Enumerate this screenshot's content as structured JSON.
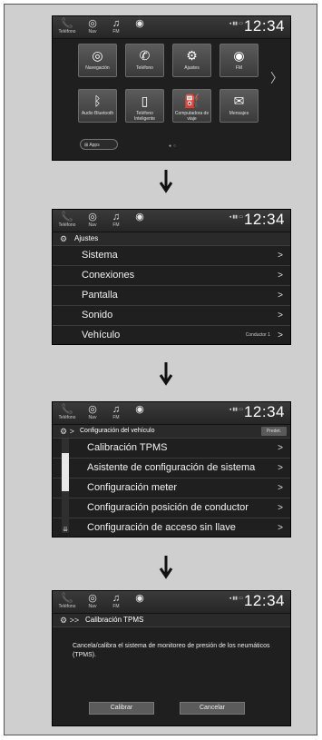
{
  "status": {
    "items": [
      {
        "label": "Teléfono",
        "icon": "phone-icon",
        "glyph": "📞"
      },
      {
        "label": "Nav",
        "icon": "navigation-icon",
        "glyph": "◎"
      },
      {
        "label": "FM",
        "icon": "radio-icon",
        "glyph": "♫"
      },
      {
        "label": "",
        "icon": "audio-source-icon",
        "glyph": "◉"
      }
    ],
    "clock": "12:34"
  },
  "home": {
    "tiles": [
      {
        "label": "Navegación",
        "icon": "navigation-icon",
        "glyph": "◎"
      },
      {
        "label": "Teléfono",
        "icon": "phone-icon",
        "glyph": "✆"
      },
      {
        "label": "Ajustes",
        "icon": "gear-icon",
        "glyph": "⚙"
      },
      {
        "label": "FM",
        "icon": "radio-icon",
        "glyph": "◉"
      },
      {
        "label": "Audio Bluetooth",
        "icon": "bluetooth-icon",
        "glyph": "ᛒ"
      },
      {
        "label": "Teléfono Inteligente",
        "icon": "smartphone-icon",
        "glyph": "▯"
      },
      {
        "label": "Computadora de viaje",
        "icon": "fuel-icon",
        "glyph": "⛽"
      },
      {
        "label": "Mensajes",
        "icon": "sms-icon",
        "glyph": "✉"
      }
    ],
    "apps_label": "Apps"
  },
  "settings": {
    "title": "Ajustes",
    "rows": [
      {
        "label": "Sistema",
        "value": ""
      },
      {
        "label": "Conexiones",
        "value": ""
      },
      {
        "label": "Pantalla",
        "value": ""
      },
      {
        "label": "Sonido",
        "value": ""
      },
      {
        "label": "Vehículo",
        "value": "Conductor 1"
      }
    ]
  },
  "vehicle": {
    "title": "Configuración del vehículo",
    "default_button": "Predet.",
    "rows": [
      {
        "label": "Calibración TPMS"
      },
      {
        "label": "Asistente de configuración de sistema"
      },
      {
        "label": "Configuración meter"
      },
      {
        "label": "Configuración posición de conductor"
      },
      {
        "label": "Configuración de acceso sin llave"
      }
    ]
  },
  "tpms": {
    "title": "Calibración TPMS",
    "message": "Cancela/calibra el sistema de monitoreo de presión de los neumáticos (TPMS).",
    "calibrate_button": "Calibrar",
    "cancel_button": "Cancelar"
  },
  "colors": {
    "screen_bg": "#1f1f1f",
    "page_bg": "#cfcfcf",
    "tile_bg": "#4a4a4a"
  }
}
